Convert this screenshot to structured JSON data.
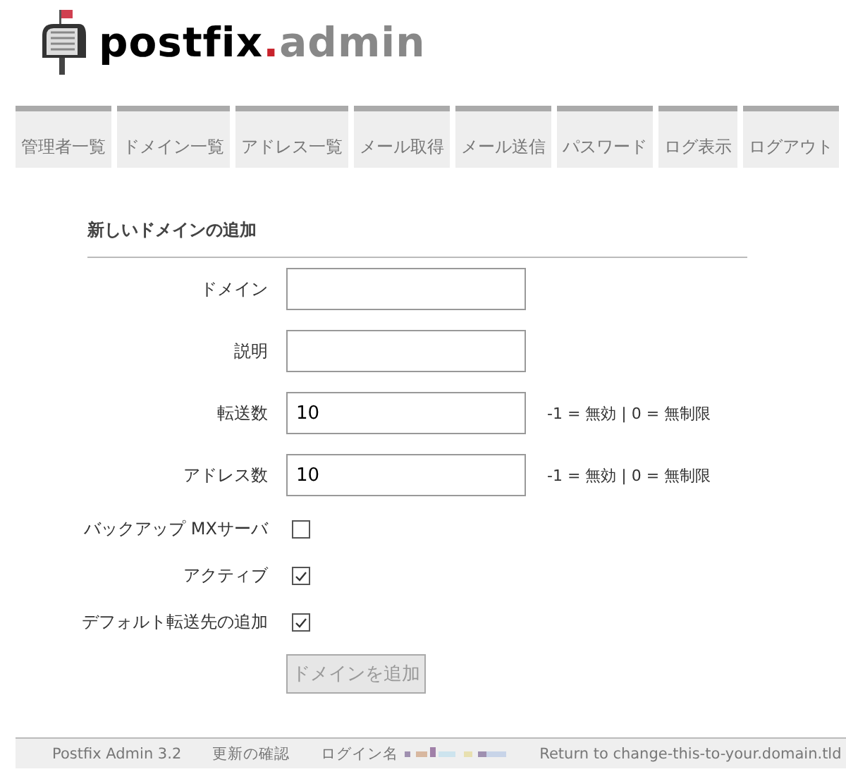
{
  "logo": {
    "name": "postfix",
    "dot": ".",
    "suffix": "admin"
  },
  "tabs": [
    {
      "label": "管理者一覧"
    },
    {
      "label": "ドメイン一覧"
    },
    {
      "label": "アドレス一覧"
    },
    {
      "label": "メール取得"
    },
    {
      "label": "メール送信"
    },
    {
      "label": "パスワード"
    },
    {
      "label": "ログ表示"
    },
    {
      "label": "ログアウト"
    }
  ],
  "form": {
    "title": "新しいドメインの追加",
    "fields": [
      {
        "kind": "text",
        "label": "ドメイン"
      },
      {
        "kind": "text",
        "label": "説明"
      },
      {
        "kind": "text",
        "label": "転送数",
        "value": "10",
        "hint": "-1 = 無効 | 0 = 無制限"
      },
      {
        "kind": "text",
        "label": "アドレス数",
        "value": "10",
        "hint": "-1 = 無効 | 0 = 無制限"
      },
      {
        "kind": "checkbox",
        "label": "バックアップ MXサーバ",
        "checked": false
      },
      {
        "kind": "checkbox",
        "label": "アクティブ",
        "checked": true
      },
      {
        "kind": "checkbox",
        "label": "デフォルト転送先の追加",
        "checked": true
      }
    ],
    "submit": {
      "label": "ドメインを追加",
      "disabled": true
    }
  },
  "footer": [
    {
      "kind": "text",
      "text": "Postfix Admin 3.2"
    },
    {
      "kind": "link",
      "text": "更新の確認"
    },
    {
      "kind": "login",
      "text": "ログイン名"
    },
    {
      "kind": "link",
      "text": "Return to change-this-to-your.domain.tld"
    }
  ]
}
